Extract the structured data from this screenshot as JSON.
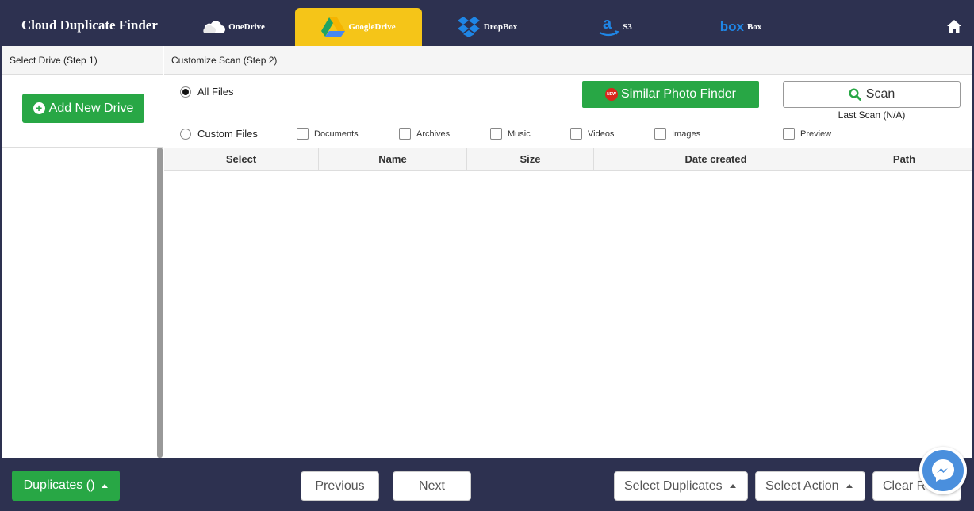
{
  "app": {
    "title": "Cloud Duplicate Finder"
  },
  "tabs": [
    {
      "label": "OneDrive",
      "icon": "onedrive-cloud-icon"
    },
    {
      "label": "GoogleDrive",
      "icon": "google-drive-icon",
      "active": true
    },
    {
      "label": "DropBox",
      "icon": "dropbox-icon"
    },
    {
      "label": "S3",
      "icon": "amazon-icon"
    },
    {
      "label": "Box",
      "icon": "box-icon",
      "logo_text": "box"
    }
  ],
  "steps": {
    "step1": "Select Drive (Step 1)",
    "step2": "Customize Scan (Step 2)"
  },
  "sidebar": {
    "add_drive": "Add New Drive"
  },
  "options": {
    "all_files": "All Files",
    "custom_files": "Custom Files",
    "selected": "all_files",
    "filters": [
      "Documents",
      "Archives",
      "Music",
      "Videos",
      "Images"
    ],
    "preview": "Preview"
  },
  "similar_photo": {
    "label": "Similar Photo Finder",
    "badge": "NEW"
  },
  "scan": {
    "label": "Scan",
    "last_scan": "Last Scan (N/A)"
  },
  "table": {
    "columns": [
      "Select",
      "Name",
      "Size",
      "Date created",
      "Path"
    ]
  },
  "footer": {
    "duplicates": "Duplicates ()",
    "previous": "Previous",
    "next": "Next",
    "select_duplicates": "Select Duplicates",
    "select_action": "Select Action",
    "clear": "Clear R"
  },
  "colors": {
    "header_bg": "#2d3150",
    "active_tab": "#f5c518",
    "primary_green": "#28a745",
    "messenger_blue": "#4a8fdd"
  }
}
